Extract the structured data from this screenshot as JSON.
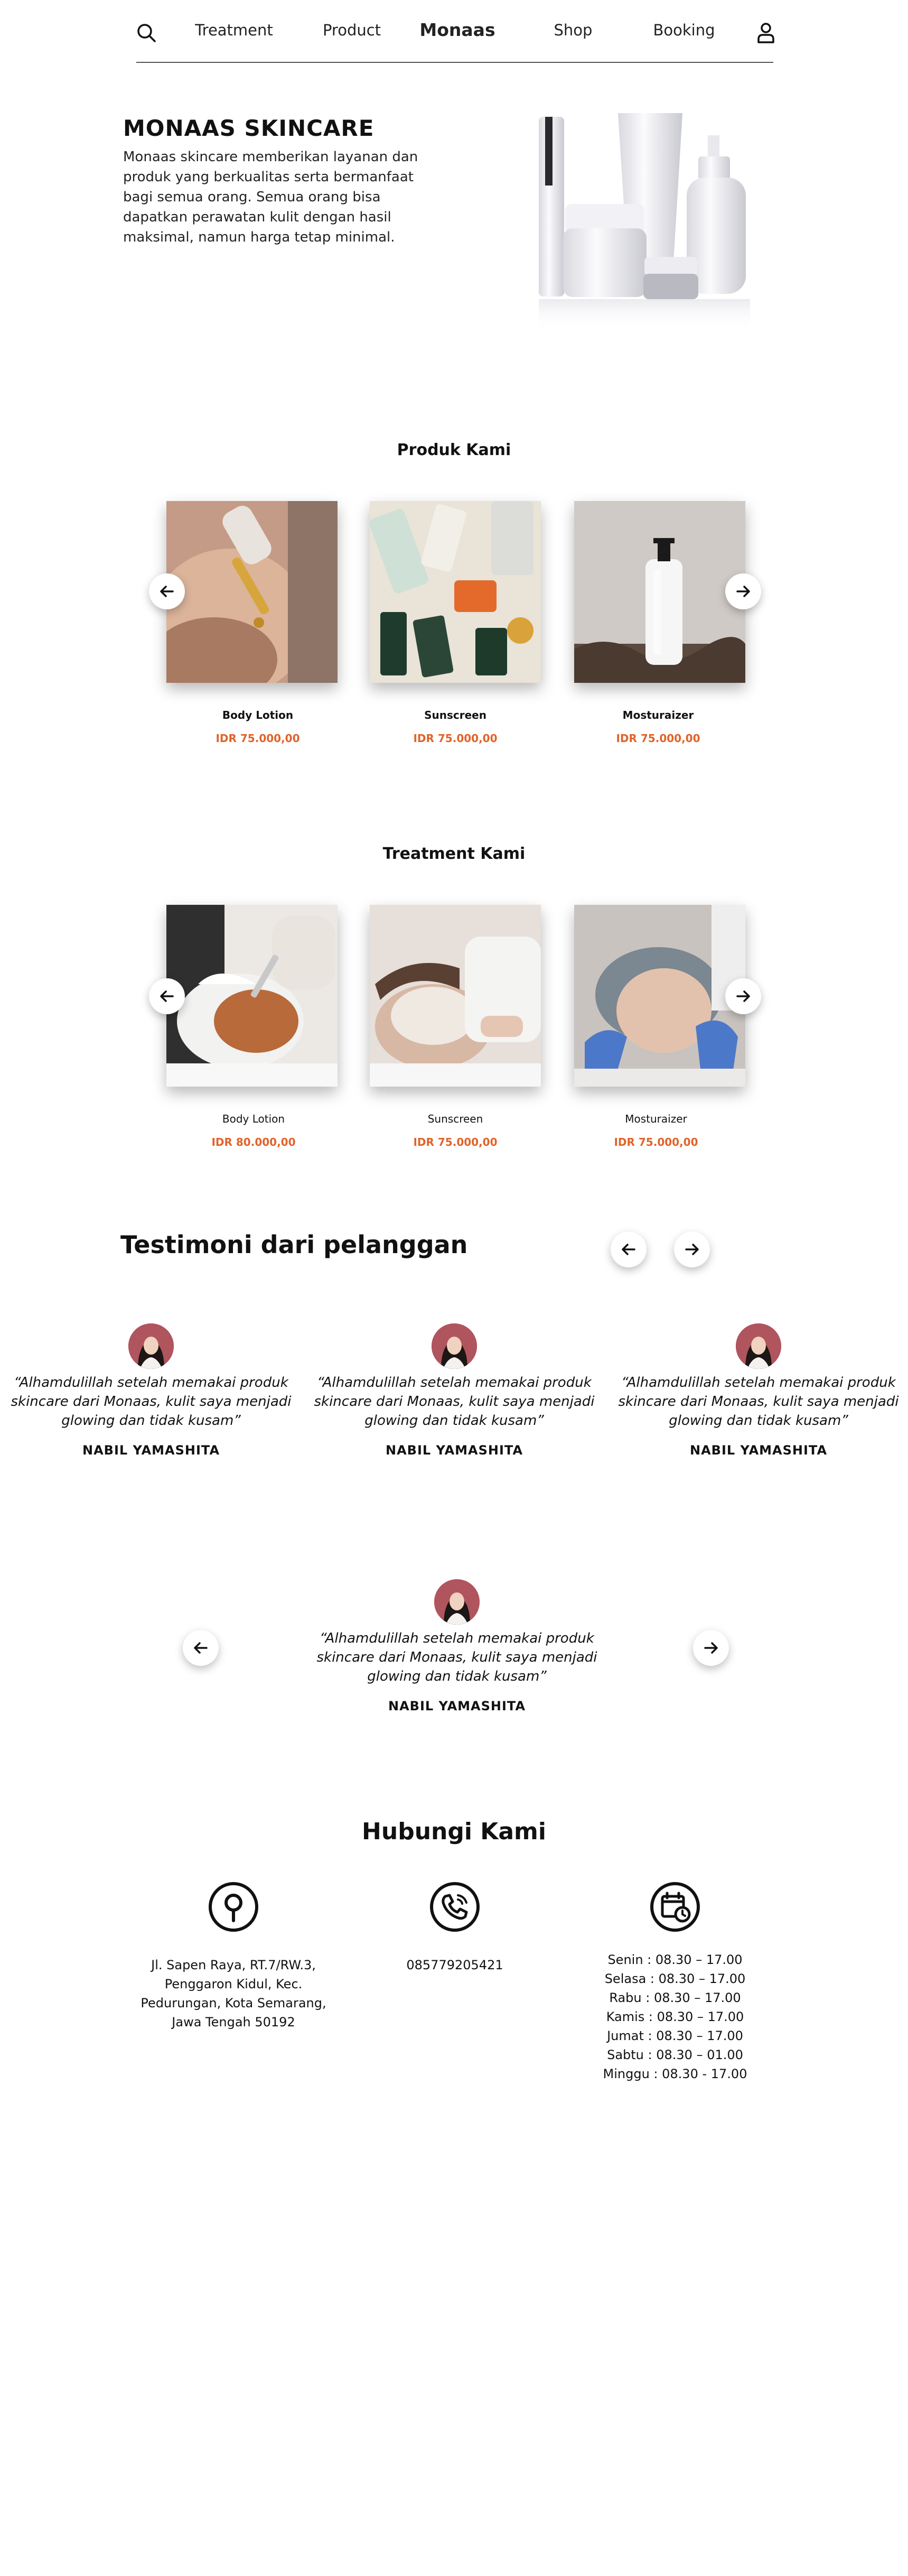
{
  "nav": {
    "items": [
      "Treatment",
      "Product",
      "Monaas",
      "Shop",
      "Booking"
    ]
  },
  "hero": {
    "title": "MONAAS SKINCARE",
    "text": "Monaas skincare memberikan layanan dan produk yang berkualitas serta bermanfaat bagi semua orang. Semua orang bisa dapatkan perawatan kulit dengan hasil maksimal, namun harga tetap minimal."
  },
  "products": {
    "title": "Produk Kami",
    "items": [
      {
        "name": "Body Lotion",
        "price": "IDR 75.000,00"
      },
      {
        "name": "Sunscreen",
        "price": "IDR 75.000,00"
      },
      {
        "name": "Mosturaizer",
        "price": "IDR 75.000,00"
      }
    ]
  },
  "treatments": {
    "title": "Treatment Kami",
    "items": [
      {
        "name": "Body Lotion",
        "price": "IDR 80.000,00"
      },
      {
        "name": "Sunscreen",
        "price": "IDR 75.000,00"
      },
      {
        "name": "Mosturaizer",
        "price": "IDR 75.000,00"
      }
    ]
  },
  "testimonials": {
    "title": "Testimoni dari pelanggan",
    "items": [
      {
        "quote": "“Alhamdulillah setelah memakai produk skincare dari Monaas, kulit saya menjadi glowing dan tidak kusam”",
        "author": "NABIL YAMASHITA"
      },
      {
        "quote": "“Alhamdulillah setelah memakai produk skincare dari Monaas, kulit saya menjadi glowing dan tidak kusam”",
        "author": "NABIL YAMASHITA"
      },
      {
        "quote": "“Alhamdulillah setelah memakai produk skincare dari Monaas, kulit saya menjadi glowing dan tidak kusam”",
        "author": "NABIL YAMASHITA"
      },
      {
        "quote": "“Alhamdulillah setelah memakai produk skincare dari Monaas, kulit saya menjadi glowing dan tidak kusam”",
        "author": "NABIL YAMASHITA"
      }
    ]
  },
  "contact": {
    "title": "Hubungi Kami",
    "address": "Jl. Sapen Raya, RT.7/RW.3, Penggaron Kidul, Kec. Pedurungan, Kota Semarang, Jawa Tengah 50192",
    "phone": "085779205421",
    "hours": [
      "Senin : 08.30 – 17.00",
      "Selasa : 08.30 – 17.00",
      "Rabu : 08.30 – 17.00",
      "Kamis : 08.30 – 17.00",
      "Jumat : 08.30 – 17.00",
      "Sabtu : 08.30 – 01.00",
      "Minggu : 08.30 - 17.00"
    ]
  },
  "icons": {
    "search": "search-icon",
    "user": "user-icon",
    "arrow_left": "arrow-left-icon",
    "arrow_right": "arrow-right-icon",
    "location": "location-pin-icon",
    "phone": "phone-icon",
    "calendar": "calendar-clock-icon"
  },
  "colors": {
    "price": "#e0632a",
    "text": "#111111",
    "background": "#ffffff"
  }
}
